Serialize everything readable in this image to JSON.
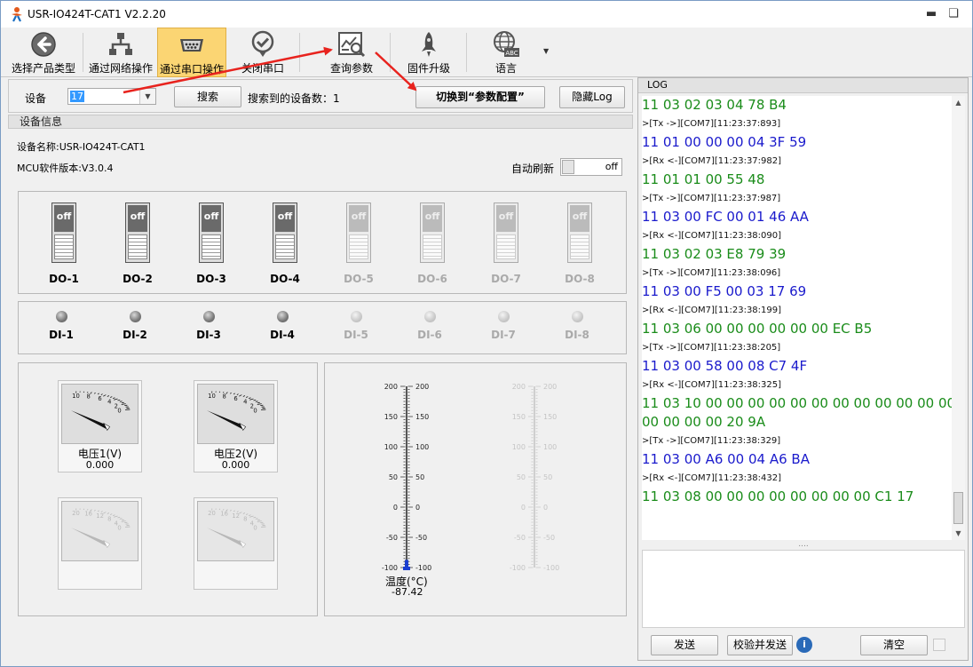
{
  "window": {
    "title": "USR-IO424T-CAT1 V2.2.20"
  },
  "toolbar": {
    "items": [
      {
        "label": "选择产品类型",
        "icon": "back-arrow-icon"
      },
      {
        "label": "通过网络操作",
        "icon": "network-icon"
      },
      {
        "label": "通过串口操作",
        "icon": "serial-port-icon"
      },
      {
        "label": "关闭串口",
        "icon": "check-circle-icon"
      },
      {
        "label": "查询参数",
        "icon": "query-params-icon"
      },
      {
        "label": "固件升级",
        "icon": "rocket-icon"
      },
      {
        "label": "语言",
        "icon": "globe-icon",
        "badge": "ABC"
      }
    ],
    "active_index": 2
  },
  "device_row": {
    "label": "设备",
    "value": "17",
    "search_button": "搜索",
    "found_text": "搜索到的设备数：1",
    "switch_button": "切换到“参数配置”",
    "hide_log_button": "隐藏Log"
  },
  "device_info": {
    "group_title": "设备信息",
    "name_text": "设备名称:USR-IO424T-CAT1",
    "mcu_text": "MCU软件版本:V3.0.4",
    "auto_refresh_label": "自动刷新",
    "auto_refresh_state": "off"
  },
  "do_outputs": [
    {
      "label": "DO-1",
      "state": "off",
      "enabled": true
    },
    {
      "label": "DO-2",
      "state": "off",
      "enabled": true
    },
    {
      "label": "DO-3",
      "state": "off",
      "enabled": true
    },
    {
      "label": "DO-4",
      "state": "off",
      "enabled": true
    },
    {
      "label": "DO-5",
      "state": "off",
      "enabled": false
    },
    {
      "label": "DO-6",
      "state": "off",
      "enabled": false
    },
    {
      "label": "DO-7",
      "state": "off",
      "enabled": false
    },
    {
      "label": "DO-8",
      "state": "off",
      "enabled": false
    }
  ],
  "di_inputs": [
    {
      "label": "DI-1",
      "enabled": true
    },
    {
      "label": "DI-2",
      "enabled": true
    },
    {
      "label": "DI-3",
      "enabled": true
    },
    {
      "label": "DI-4",
      "enabled": true
    },
    {
      "label": "DI-5",
      "enabled": false
    },
    {
      "label": "DI-6",
      "enabled": false
    },
    {
      "label": "DI-7",
      "enabled": false
    },
    {
      "label": "DI-8",
      "enabled": false
    }
  ],
  "meters": [
    {
      "name": "电压1(V)",
      "value": "0.000",
      "ticks": [
        "0",
        "2",
        "4",
        "6",
        "8",
        "10"
      ],
      "enabled": true
    },
    {
      "name": "电压2(V)",
      "value": "0.000",
      "ticks": [
        "0",
        "2",
        "4",
        "6",
        "8",
        "10"
      ],
      "enabled": true
    },
    {
      "name": "",
      "value": "",
      "ticks": [
        "0",
        "4",
        "8",
        "12",
        "16",
        "20"
      ],
      "enabled": false
    },
    {
      "name": "",
      "value": "",
      "ticks": [
        "0",
        "4",
        "8",
        "12",
        "16",
        "20"
      ],
      "enabled": false
    }
  ],
  "thermometers": [
    {
      "name": "温度(°C)",
      "value": "-87.42",
      "reading": -87.42,
      "min": -100,
      "max": 200,
      "ticks": [
        "200",
        "150",
        "100",
        "50",
        "0",
        "-50",
        "-100"
      ],
      "enabled": true
    },
    {
      "name": "",
      "value": "",
      "min": -100,
      "max": 200,
      "ticks": [
        "200",
        "150",
        "100",
        "50",
        "0",
        "-50",
        "-100"
      ],
      "enabled": false
    }
  ],
  "log": {
    "title": "LOG",
    "lines": [
      {
        "text": "11 03 02 03 04 78 B4",
        "kind": "rx"
      },
      {
        "text": ">[Tx ->][COM7][11:23:37:893]",
        "kind": "meta"
      },
      {
        "text": "11 01 00 00 00 04 3F 59",
        "kind": "tx"
      },
      {
        "text": ">[Rx <-][COM7][11:23:37:982]",
        "kind": "meta"
      },
      {
        "text": "11 01 01 00 55 48",
        "kind": "rx"
      },
      {
        "text": ">[Tx ->][COM7][11:23:37:987]",
        "kind": "meta"
      },
      {
        "text": "11 03 00 FC 00 01 46 AA",
        "kind": "tx"
      },
      {
        "text": ">[Rx <-][COM7][11:23:38:090]",
        "kind": "meta"
      },
      {
        "text": "11 03 02 03 E8 79 39",
        "kind": "rx"
      },
      {
        "text": ">[Tx ->][COM7][11:23:38:096]",
        "kind": "meta"
      },
      {
        "text": "11 03 00 F5 00 03 17 69",
        "kind": "tx"
      },
      {
        "text": ">[Rx <-][COM7][11:23:38:199]",
        "kind": "meta"
      },
      {
        "text": "11 03 06 00 00 00 00 00 00 EC B5",
        "kind": "rx"
      },
      {
        "text": ">[Tx ->][COM7][11:23:38:205]",
        "kind": "meta"
      },
      {
        "text": "11 03 00 58 00 08 C7 4F",
        "kind": "tx"
      },
      {
        "text": ">[Rx <-][COM7][11:23:38:325]",
        "kind": "meta"
      },
      {
        "text": "11 03 10 00 00 00 00 00 00 00 00 00 00 00 00",
        "kind": "rx"
      },
      {
        "text": "00 00 00 00 20 9A",
        "kind": "rx"
      },
      {
        "text": ">[Tx ->][COM7][11:23:38:329]",
        "kind": "meta"
      },
      {
        "text": "11 03 00 A6 00 04 A6 BA",
        "kind": "tx"
      },
      {
        "text": ">[Rx <-][COM7][11:23:38:432]",
        "kind": "meta"
      },
      {
        "text": "11 03 08 00 00 00 00 00 00 00 00 C1 17",
        "kind": "rx"
      }
    ],
    "splitter": "....",
    "send_button": "发送",
    "check_send_button": "校验并发送",
    "clear_button": "清空"
  },
  "colors": {
    "tx": "#1a1acc",
    "rx": "#1a8c1a",
    "annotation_arrow": "#e8231e",
    "active_toolbar": "#fbd573"
  }
}
